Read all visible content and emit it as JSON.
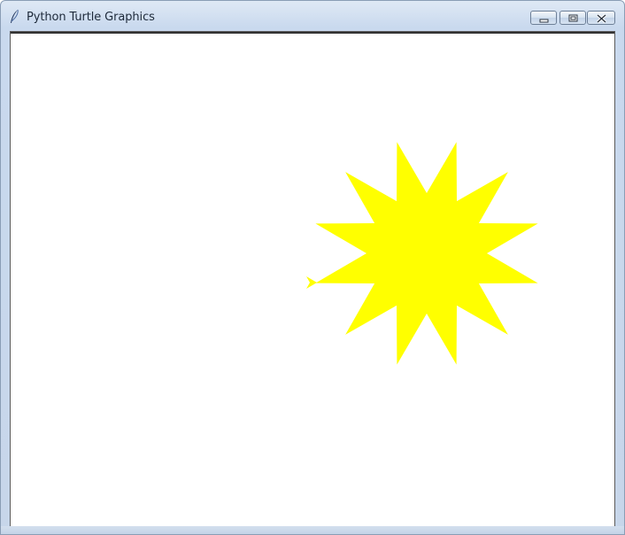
{
  "window": {
    "title": "Python Turtle Graphics",
    "icon": "feather-icon"
  },
  "controls": {
    "minimize_icon": "minimize-icon",
    "maximize_icon": "maximize-icon",
    "close_icon": "close-icon"
  },
  "canvas": {
    "background": "#ffffff",
    "shape": "12-point star",
    "fill_color": "#ffff00",
    "turtle_color": "#ffff00"
  }
}
